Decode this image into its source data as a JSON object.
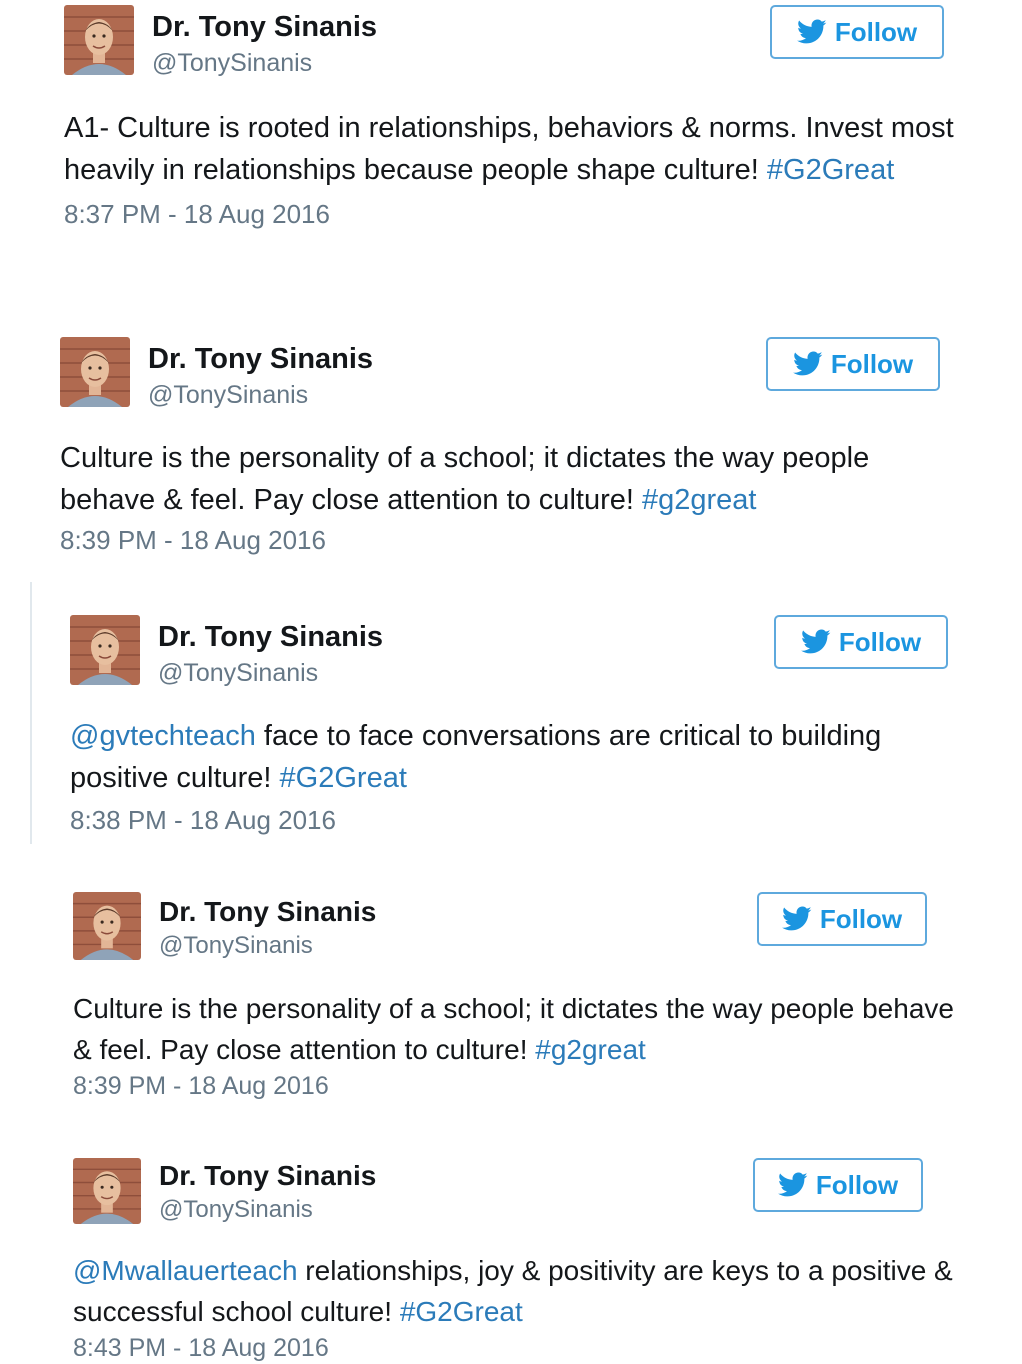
{
  "colors": {
    "link": "#2b7bb9",
    "follow_blue": "#1b95e0",
    "follow_border": "#5ea9dd",
    "secondary_text": "#657786",
    "quote_border": "#e1e8ed"
  },
  "tweets": [
    {
      "name": "Dr. Tony Sinanis",
      "handle": "@TonySinanis",
      "follow_label": "Follow",
      "text_before": "",
      "mention": "",
      "text_middle": "A1- Culture is rooted in relationships, behaviors & norms. Invest most heavily in relationships because people shape culture! ",
      "hashtag": "#G2Great",
      "timestamp": "8:37 PM - 18 Aug 2016"
    },
    {
      "name": "Dr. Tony Sinanis",
      "handle": "@TonySinanis",
      "follow_label": "Follow",
      "mention": "",
      "text_middle": "Culture is the personality of a school; it dictates the way people behave & feel. Pay close attention to culture! ",
      "hashtag": "#g2great",
      "timestamp": "8:39 PM - 18 Aug 2016"
    },
    {
      "name": "Dr. Tony Sinanis",
      "handle": "@TonySinanis",
      "follow_label": "Follow",
      "mention": "@gvtechteach",
      "text_middle": " face to face conversations are critical to building positive culture! ",
      "hashtag": "#G2Great",
      "timestamp": "8:38 PM - 18 Aug 2016"
    },
    {
      "name": "Dr. Tony Sinanis",
      "handle": "@TonySinanis",
      "follow_label": "Follow",
      "mention": "",
      "text_middle": "Culture is the personality of a school; it dictates the way people behave & feel. Pay close attention to culture! ",
      "hashtag": "#g2great",
      "timestamp": "8:39 PM - 18 Aug 2016"
    },
    {
      "name": "Dr. Tony Sinanis",
      "handle": "@TonySinanis",
      "follow_label": "Follow",
      "mention": "@Mwallauerteach",
      "text_middle": " relationships, joy & positivity are keys to a positive & successful school culture! ",
      "hashtag": "#G2Great",
      "timestamp": "8:43 PM - 18 Aug 2016"
    }
  ]
}
